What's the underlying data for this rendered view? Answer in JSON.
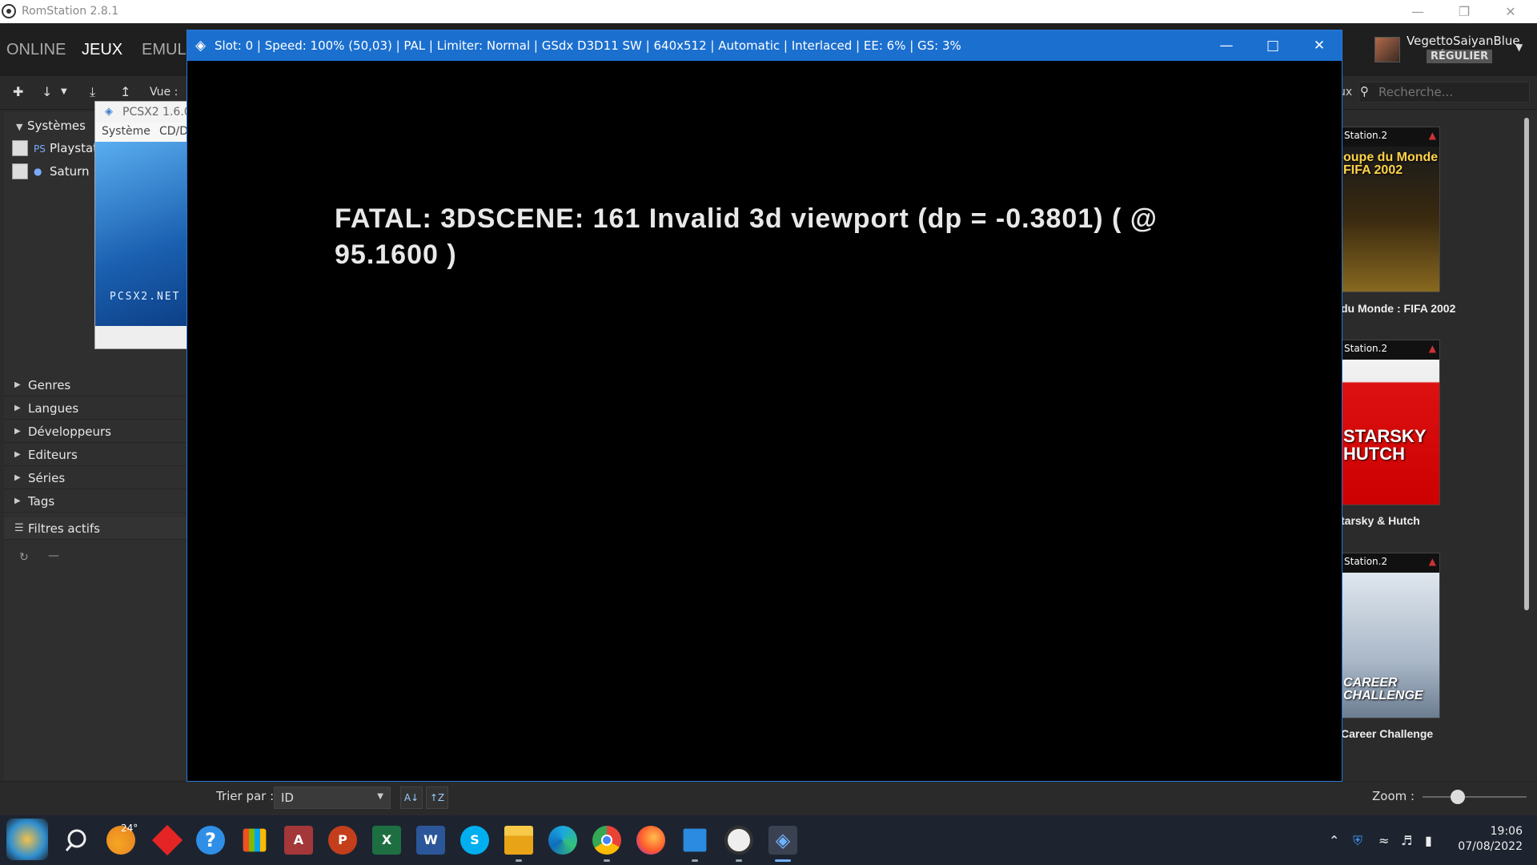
{
  "romstation": {
    "title": "RomStation 2.8.1",
    "nav": {
      "online": "ONLINE",
      "jeux": "JEUX",
      "emul": "EMUL"
    },
    "user": {
      "name": "VegettoSaiyanBlue",
      "rank": "RÉGULIER"
    },
    "toolbar": {
      "vue_label": "Vue :",
      "ax_label": "ux"
    },
    "search": {
      "placeholder": "Recherche..."
    },
    "sidebar": {
      "systemes": "Systèmes",
      "systems": [
        {
          "label": "Playstat"
        },
        {
          "label": "Saturn"
        }
      ],
      "sections": [
        "Genres",
        "Langues",
        "Développeurs",
        "Editeurs",
        "Séries",
        "Tags"
      ],
      "active_filters": "Filtres actifs"
    },
    "games": [
      {
        "band": "Station.2",
        "cover_text": "oupe du Monde FIFA 2002",
        "title": "du Monde : FIFA 2002"
      },
      {
        "band": "Station.2",
        "cover_text": "STARSKY HUTCH",
        "title": "tarsky & Hutch"
      },
      {
        "band": "Station.2",
        "cover_text": "CAREER CHALLENGE",
        "title": "Career Challenge"
      }
    ],
    "bottom": {
      "sort_label": "Trier par :",
      "sort_value": "ID",
      "zoom_label": "Zoom :"
    }
  },
  "pcsx2": {
    "title": "PCSX2  1.6.0",
    "menu": {
      "systeme": "Système",
      "cd": "CD/D"
    },
    "splash_text": "PCSX2.NET"
  },
  "gs": {
    "title": "Slot: 0 | Speed: 100% (50,03) | PAL | Limiter: Normal | GSdx D3D11 SW | 640x512 | Automatic | Interlaced | EE:  6% | GS:  3%",
    "fatal": "FATAL: 3DSCENE: 161 Invalid 3d viewport (dp = -0.3801) ( @ 95.1600 )"
  },
  "taskbar": {
    "weather_temp": "24°",
    "time": "19:06",
    "date": "07/08/2022"
  },
  "colors": {
    "gs_title_bar": "#1b6fcf",
    "rs_nav": "#1f1f1f",
    "taskbar": "#1d2430"
  }
}
